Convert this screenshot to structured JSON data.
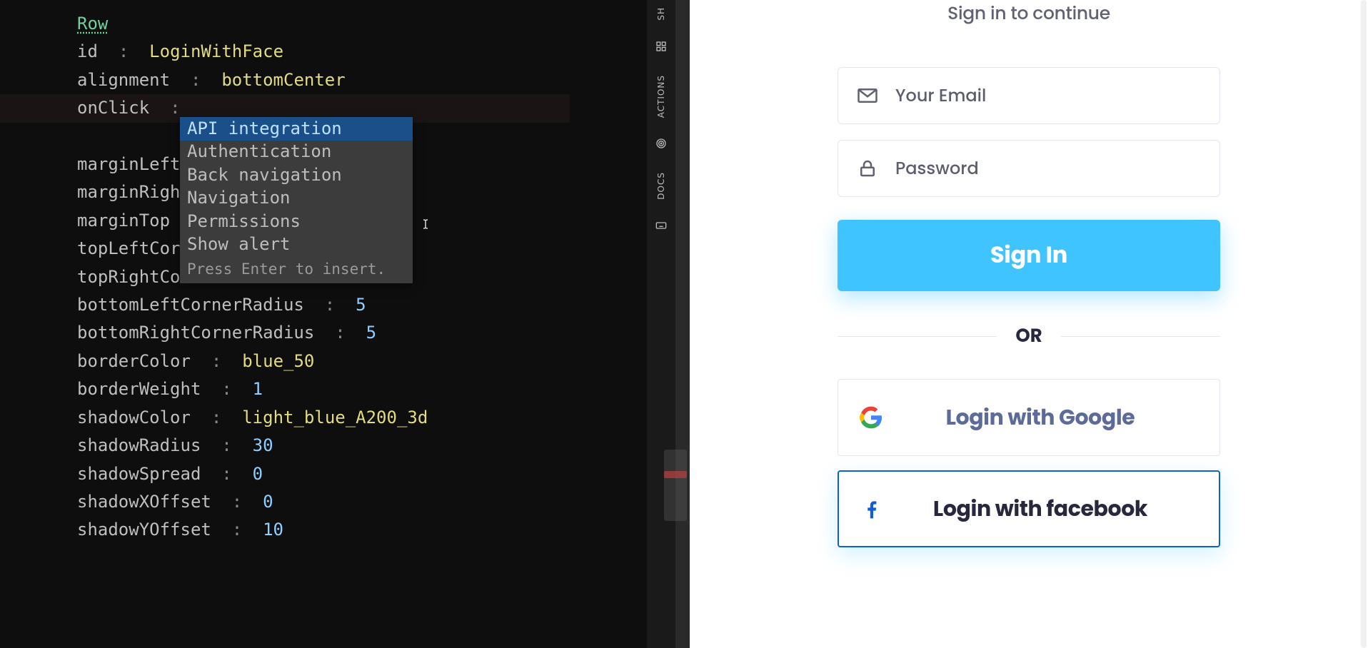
{
  "editor": {
    "component_type": "Row",
    "properties": [
      {
        "key": "id",
        "value": "LoginWithFace",
        "value_class": "tok-str"
      },
      {
        "key": "alignment",
        "value": "bottomCenter",
        "value_class": "tok-enum"
      },
      {
        "key": "onClick",
        "value": "",
        "value_class": "",
        "highlighted": true
      },
      {
        "key": "marginLeft",
        "value": "",
        "value_class": ""
      },
      {
        "key": "marginRight",
        "value": "",
        "value_class": ""
      },
      {
        "key": "marginTop",
        "value": "",
        "value_class": ""
      },
      {
        "key": "topLeftCorne",
        "value": "",
        "value_class": ""
      },
      {
        "key": "topRightCorn",
        "value": "",
        "value_class": ""
      },
      {
        "key": "bottomLeftCornerRadius",
        "value": "5",
        "value_class": "tok-num"
      },
      {
        "key": "bottomRightCornerRadius",
        "value": "5",
        "value_class": "tok-num"
      },
      {
        "key": "borderColor",
        "value": "blue_50",
        "value_class": "tok-enum"
      },
      {
        "key": "borderWeight",
        "value": "1",
        "value_class": "tok-num"
      },
      {
        "key": "shadowColor",
        "value": "light_blue_A200_3d",
        "value_class": "tok-enum"
      },
      {
        "key": "shadowRadius",
        "value": "30",
        "value_class": "tok-num"
      },
      {
        "key": "shadowSpread",
        "value": "0",
        "value_class": "tok-num"
      },
      {
        "key": "shadowXOffset",
        "value": "0",
        "value_class": "tok-num"
      },
      {
        "key": "shadowYOffset",
        "value": "10",
        "value_class": "tok-num"
      }
    ],
    "autocomplete": {
      "items": [
        "API integration",
        "Authentication",
        "Back navigation",
        "Navigation",
        "Permissions",
        "Show alert"
      ],
      "selected_index": 0,
      "hint": "Press Enter to insert."
    }
  },
  "rail": {
    "items": [
      {
        "id": "show",
        "label": "SH",
        "icon": "grid"
      },
      {
        "id": "actions",
        "label": "ACTIONS",
        "icon": "target"
      },
      {
        "id": "docs",
        "label": "DOCS",
        "icon": "keyboard"
      }
    ]
  },
  "preview": {
    "subtitle": "Sign in to continue",
    "email_placeholder": "Your Email",
    "password_placeholder": "Password",
    "sign_in_label": "Sign In",
    "or_label": "OR",
    "google_label": "Login with Google",
    "facebook_label": "Login with facebook"
  }
}
